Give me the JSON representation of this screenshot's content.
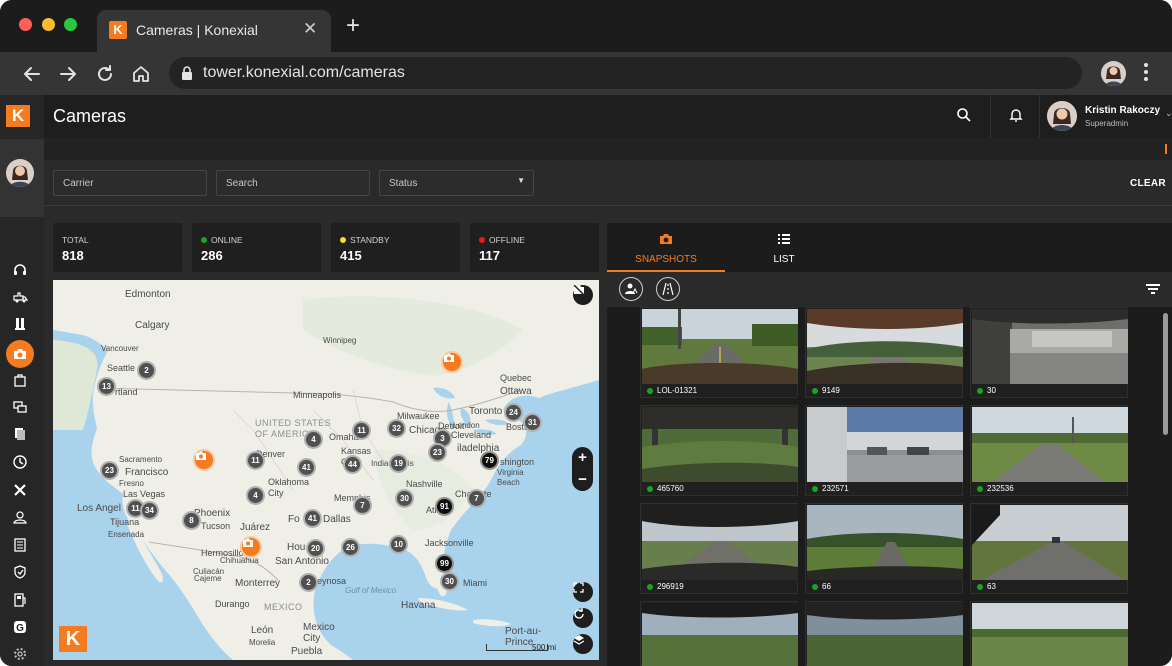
{
  "browser": {
    "tab_title": "Cameras | Konexial",
    "favicon_letter": "K",
    "url": "tower.konexial.com/cameras",
    "icons": [
      "back-icon",
      "forward-icon",
      "reload-icon",
      "home-icon",
      "lock-icon",
      "kebab-menu-icon"
    ]
  },
  "app": {
    "brand_letter": "K",
    "page_title": "Cameras",
    "user": {
      "name": "Kristin Rakoczy",
      "role": "Superadmin"
    },
    "accent_color": "#f47b20",
    "sidebar_icons": [
      "headset-icon",
      "truck-icon",
      "fuel-icon",
      "camera-icon",
      "bag-icon",
      "chat-icon",
      "documents-icon",
      "clock-icon",
      "tools-icon",
      "driver-icon",
      "logbook-icon",
      "shield-icon",
      "fuel-receipt-icon",
      "gauge-icon",
      "settings-icon"
    ]
  },
  "filters": {
    "carrier_placeholder": "Carrier",
    "search_placeholder": "Search",
    "status_placeholder": "Status",
    "clear_label": "CLEAR"
  },
  "stats": [
    {
      "label": "TOTAL",
      "value": "818",
      "dot": null
    },
    {
      "label": "ONLINE",
      "value": "286",
      "dot": "#1aa51a"
    },
    {
      "label": "STANDBY",
      "value": "415",
      "dot": "#f1e21a"
    },
    {
      "label": "OFFLINE",
      "value": "117",
      "dot": "#e0201c"
    }
  ],
  "map": {
    "labels": {
      "edmonton": "Edmonton",
      "calgary": "Calgary",
      "vancouver": "Vancouver",
      "seattle": "Seattle",
      "portland": "rtland",
      "winnipeg": "Winnipeg",
      "quebec": "Quebec",
      "ottawa": "Ottawa",
      "toronto": "Toronto",
      "boston": "Bosto",
      "minneapolis": "Minneapolis",
      "milwaukee": "Milwaukee",
      "chicago": "Chicago",
      "detroit": "Detroit",
      "london": "London",
      "cleveland": "Cleveland",
      "omaha": "Omaha",
      "philadelphia": "iladelphia",
      "washington": "shington",
      "virginia_beach": "Virginia\nBeach",
      "us": "UNITED STATES\nOF AMERICA",
      "kansas_city": "Kansas\nCity",
      "indianapolis": "Indianapolis",
      "denver": "Denver",
      "sf": "Francisco",
      "sacramento": "Sacramento",
      "fresno": "Fresno",
      "las_vegas": "Las Vegas",
      "los_angeles": "Los Angel",
      "tijuana": "Tijuana",
      "ensenada": "Ensenada",
      "phoenix": "Phoenix",
      "tucson": "Tucson",
      "oklahoma": "Oklahoma\nCity",
      "memphis": "Memphis",
      "nashville": "Nashville",
      "charlotte": "Charlotte",
      "atlanta": "Atla",
      "fort_worth": "Fo",
      "dallas": "Dallas",
      "juarez": "Juárez",
      "hermosillo": "Hermosillo",
      "chihuahua": "Chihuahua",
      "houston": "Hou",
      "san_antonio": "San Antonio",
      "jacksonville": "Jacksonville",
      "miami": "Miami",
      "culiacan": "Culiacán",
      "monterrey": "Monterrey",
      "reynosa": "eynosa",
      "cajeme": "Cajeme",
      "durango": "Durango",
      "mexico": "MEXICO",
      "gulf": "Gulf of Mexico",
      "havana": "Havana",
      "leon": "León",
      "mexico_city": "Mexico\nCity",
      "puebla": "Puebla",
      "morelia": "Morelia",
      "port_au_prince": "Port-au-\nPrince",
      "scale": "500 mi"
    },
    "clusters": [
      {
        "n": "13",
        "dark": false
      },
      {
        "n": "2",
        "dark": false
      },
      {
        "n": "4",
        "dark": false
      },
      {
        "n": "11",
        "dark": false
      },
      {
        "n": "32",
        "dark": false
      },
      {
        "n": "3",
        "dark": false
      },
      {
        "n": "24",
        "dark": false
      },
      {
        "n": "31",
        "dark": false
      },
      {
        "n": "44",
        "dark": false
      },
      {
        "n": "19",
        "dark": false
      },
      {
        "n": "23",
        "dark": false
      },
      {
        "n": "79",
        "dark": true
      },
      {
        "n": "11",
        "dark": false
      },
      {
        "n": "41",
        "dark": false
      },
      {
        "n": "23",
        "dark": false
      },
      {
        "n": "4",
        "dark": false
      },
      {
        "n": "7",
        "dark": false
      },
      {
        "n": "30",
        "dark": false
      },
      {
        "n": "91",
        "dark": true
      },
      {
        "n": "7",
        "dark": false
      },
      {
        "n": "11",
        "dark": false
      },
      {
        "n": "34",
        "dark": false
      },
      {
        "n": "8",
        "dark": false
      },
      {
        "n": "41",
        "dark": false
      },
      {
        "n": "20",
        "dark": false
      },
      {
        "n": "26",
        "dark": false
      },
      {
        "n": "10",
        "dark": false
      },
      {
        "n": "99",
        "dark": true
      },
      {
        "n": "30",
        "dark": false
      },
      {
        "n": "2",
        "dark": false
      }
    ]
  },
  "panel": {
    "tabs": [
      {
        "label": "SNAPSHOTS",
        "icon": "camera-icon",
        "active": true
      },
      {
        "label": "LIST",
        "icon": "list-icon",
        "active": false
      }
    ],
    "snapshots": [
      {
        "label": "LOL-01321",
        "status": "online"
      },
      {
        "label": "9149",
        "status": "online"
      },
      {
        "label": "30",
        "status": "online"
      },
      {
        "label": "465760",
        "status": "online"
      },
      {
        "label": "232571",
        "status": "online"
      },
      {
        "label": "232536",
        "status": "online"
      },
      {
        "label": "296919",
        "status": "online"
      },
      {
        "label": "66",
        "status": "online"
      },
      {
        "label": "63",
        "status": "online"
      },
      {
        "label": "",
        "status": ""
      },
      {
        "label": "",
        "status": ""
      },
      {
        "label": "",
        "status": ""
      }
    ]
  }
}
